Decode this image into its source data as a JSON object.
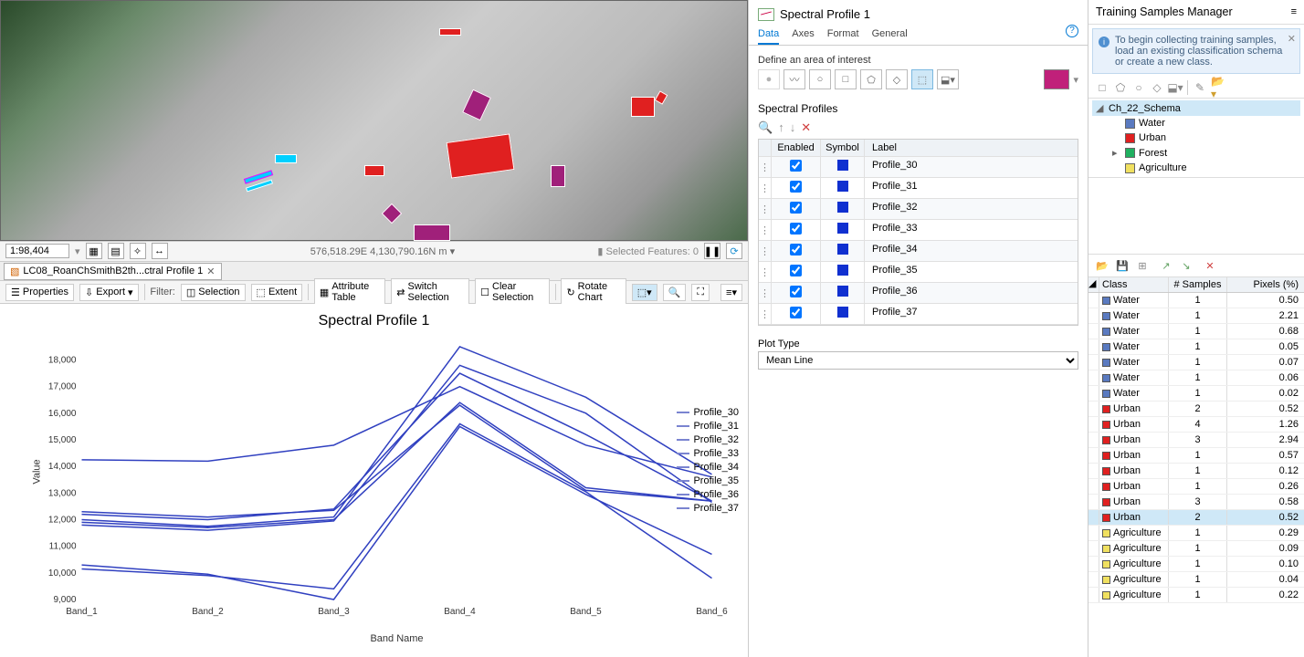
{
  "map": {
    "scale": "1:98,404",
    "coords": "576,518.29E 4,130,790.16N m",
    "selected_features": "Selected Features: 0"
  },
  "tab": {
    "label": "LC08_RoanChSmithB2th...ctral Profile 1"
  },
  "chart_toolbar": {
    "properties": "Properties",
    "export": "Export",
    "filter": "Filter:",
    "selection": "Selection",
    "extent": "Extent",
    "attr_table": "Attribute Table",
    "switch_sel": "Switch Selection",
    "clear_sel": "Clear Selection",
    "rotate": "Rotate Chart"
  },
  "chart_data": {
    "type": "line",
    "title": "Spectral Profile 1",
    "xlabel": "Band Name",
    "ylabel": "Value",
    "categories": [
      "Band_1",
      "Band_2",
      "Band_3",
      "Band_4",
      "Band_5",
      "Band_6"
    ],
    "yticks": [
      9000,
      10000,
      11000,
      12000,
      13000,
      14000,
      15000,
      16000,
      17000,
      18000
    ],
    "ylim": [
      9000,
      18600
    ],
    "series": [
      {
        "name": "Profile_30",
        "values": [
          12300,
          12100,
          12350,
          16300,
          13100,
          12700
        ]
      },
      {
        "name": "Profile_31",
        "values": [
          12000,
          11750,
          12100,
          18500,
          16600,
          13700
        ]
      },
      {
        "name": "Profile_32",
        "values": [
          11800,
          11600,
          11950,
          17800,
          16000,
          12650
        ]
      },
      {
        "name": "Profile_33",
        "values": [
          10150,
          9900,
          9400,
          15600,
          13050,
          9800
        ]
      },
      {
        "name": "Profile_34",
        "values": [
          14250,
          14200,
          14800,
          17000,
          14800,
          13600
        ]
      },
      {
        "name": "Profile_35",
        "values": [
          10300,
          9950,
          9000,
          15500,
          12950,
          10700
        ]
      },
      {
        "name": "Profile_36",
        "values": [
          12200,
          12000,
          12400,
          17500,
          15200,
          12700
        ]
      },
      {
        "name": "Profile_37",
        "values": [
          11900,
          11700,
          12000,
          16400,
          13200,
          12700
        ]
      }
    ]
  },
  "mid": {
    "title": "Spectral Profile 1",
    "tabs": {
      "data": "Data",
      "axes": "Axes",
      "format": "Format",
      "general": "General"
    },
    "aoi_label": "Define an area of interest",
    "profiles_label": "Spectral Profiles",
    "table_head": {
      "enabled": "Enabled",
      "symbol": "Symbol",
      "label": "Label"
    },
    "profiles": [
      "Profile_30",
      "Profile_31",
      "Profile_32",
      "Profile_33",
      "Profile_34",
      "Profile_35",
      "Profile_36",
      "Profile_37"
    ],
    "plot_type_label": "Plot Type",
    "plot_type_value": "Mean Line"
  },
  "right": {
    "title": "Training Samples Manager",
    "info": "To begin collecting training samples, load an existing classification schema or create a new class.",
    "schema_name": "Ch_22_Schema",
    "classes": [
      {
        "name": "Water",
        "color": "#5a7ac0"
      },
      {
        "name": "Urban",
        "color": "#e02020"
      },
      {
        "name": "Forest",
        "color": "#20b060"
      },
      {
        "name": "Agriculture",
        "color": "#f0e060"
      }
    ],
    "samples_head": {
      "class": "Class",
      "samples": "# Samples",
      "pixels": "Pixels (%)"
    },
    "samples": [
      {
        "cls": "Water",
        "color": "#5a7ac0",
        "n": 1,
        "p": "0.50"
      },
      {
        "cls": "Water",
        "color": "#5a7ac0",
        "n": 1,
        "p": "2.21"
      },
      {
        "cls": "Water",
        "color": "#5a7ac0",
        "n": 1,
        "p": "0.68"
      },
      {
        "cls": "Water",
        "color": "#5a7ac0",
        "n": 1,
        "p": "0.05"
      },
      {
        "cls": "Water",
        "color": "#5a7ac0",
        "n": 1,
        "p": "0.07"
      },
      {
        "cls": "Water",
        "color": "#5a7ac0",
        "n": 1,
        "p": "0.06"
      },
      {
        "cls": "Water",
        "color": "#5a7ac0",
        "n": 1,
        "p": "0.02"
      },
      {
        "cls": "Urban",
        "color": "#e02020",
        "n": 2,
        "p": "0.52"
      },
      {
        "cls": "Urban",
        "color": "#e02020",
        "n": 4,
        "p": "1.26"
      },
      {
        "cls": "Urban",
        "color": "#e02020",
        "n": 3,
        "p": "2.94"
      },
      {
        "cls": "Urban",
        "color": "#e02020",
        "n": 1,
        "p": "0.57"
      },
      {
        "cls": "Urban",
        "color": "#e02020",
        "n": 1,
        "p": "0.12"
      },
      {
        "cls": "Urban",
        "color": "#e02020",
        "n": 1,
        "p": "0.26"
      },
      {
        "cls": "Urban",
        "color": "#e02020",
        "n": 3,
        "p": "0.58"
      },
      {
        "cls": "Urban",
        "color": "#e02020",
        "n": 2,
        "p": "0.52",
        "sel": true
      },
      {
        "cls": "Agriculture",
        "color": "#f0e060",
        "n": 1,
        "p": "0.29"
      },
      {
        "cls": "Agriculture",
        "color": "#f0e060",
        "n": 1,
        "p": "0.09"
      },
      {
        "cls": "Agriculture",
        "color": "#f0e060",
        "n": 1,
        "p": "0.10"
      },
      {
        "cls": "Agriculture",
        "color": "#f0e060",
        "n": 1,
        "p": "0.04"
      },
      {
        "cls": "Agriculture",
        "color": "#f0e060",
        "n": 1,
        "p": "0.22"
      }
    ]
  }
}
